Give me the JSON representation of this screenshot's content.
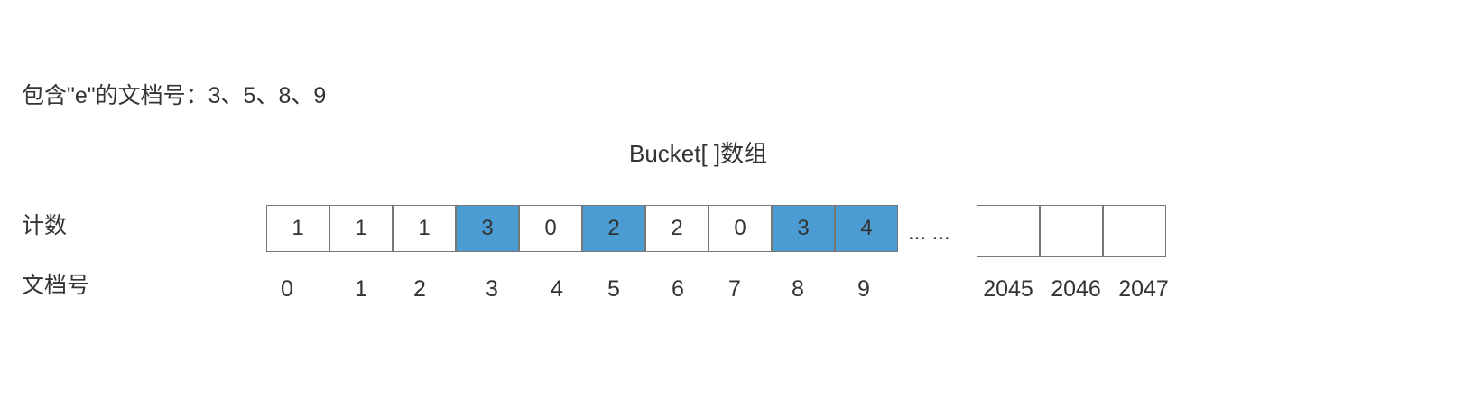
{
  "caption": "包含\"e\"的文档号：3、5、8、9",
  "title": "Bucket[ ]数组",
  "labels": {
    "count": "计数",
    "doc_id": "文档号"
  },
  "cells": [
    {
      "count": "1",
      "doc_id": "0",
      "highlighted": false
    },
    {
      "count": "1",
      "doc_id": "1",
      "highlighted": false
    },
    {
      "count": "1",
      "doc_id": "2",
      "highlighted": false
    },
    {
      "count": "3",
      "doc_id": "3",
      "highlighted": true
    },
    {
      "count": "0",
      "doc_id": "4",
      "highlighted": false
    },
    {
      "count": "2",
      "doc_id": "5",
      "highlighted": true
    },
    {
      "count": "2",
      "doc_id": "6",
      "highlighted": false
    },
    {
      "count": "0",
      "doc_id": "7",
      "highlighted": false
    },
    {
      "count": "3",
      "doc_id": "8",
      "highlighted": true
    },
    {
      "count": "4",
      "doc_id": "9",
      "highlighted": true
    }
  ],
  "ellipsis": "... ...",
  "tail_cells": [
    {
      "count": "",
      "doc_id": "2045"
    },
    {
      "count": "",
      "doc_id": "2046"
    },
    {
      "count": "",
      "doc_id": "2047"
    }
  ],
  "colors": {
    "highlight": "#4b9cd3",
    "border": "#777777",
    "text": "#333333"
  }
}
